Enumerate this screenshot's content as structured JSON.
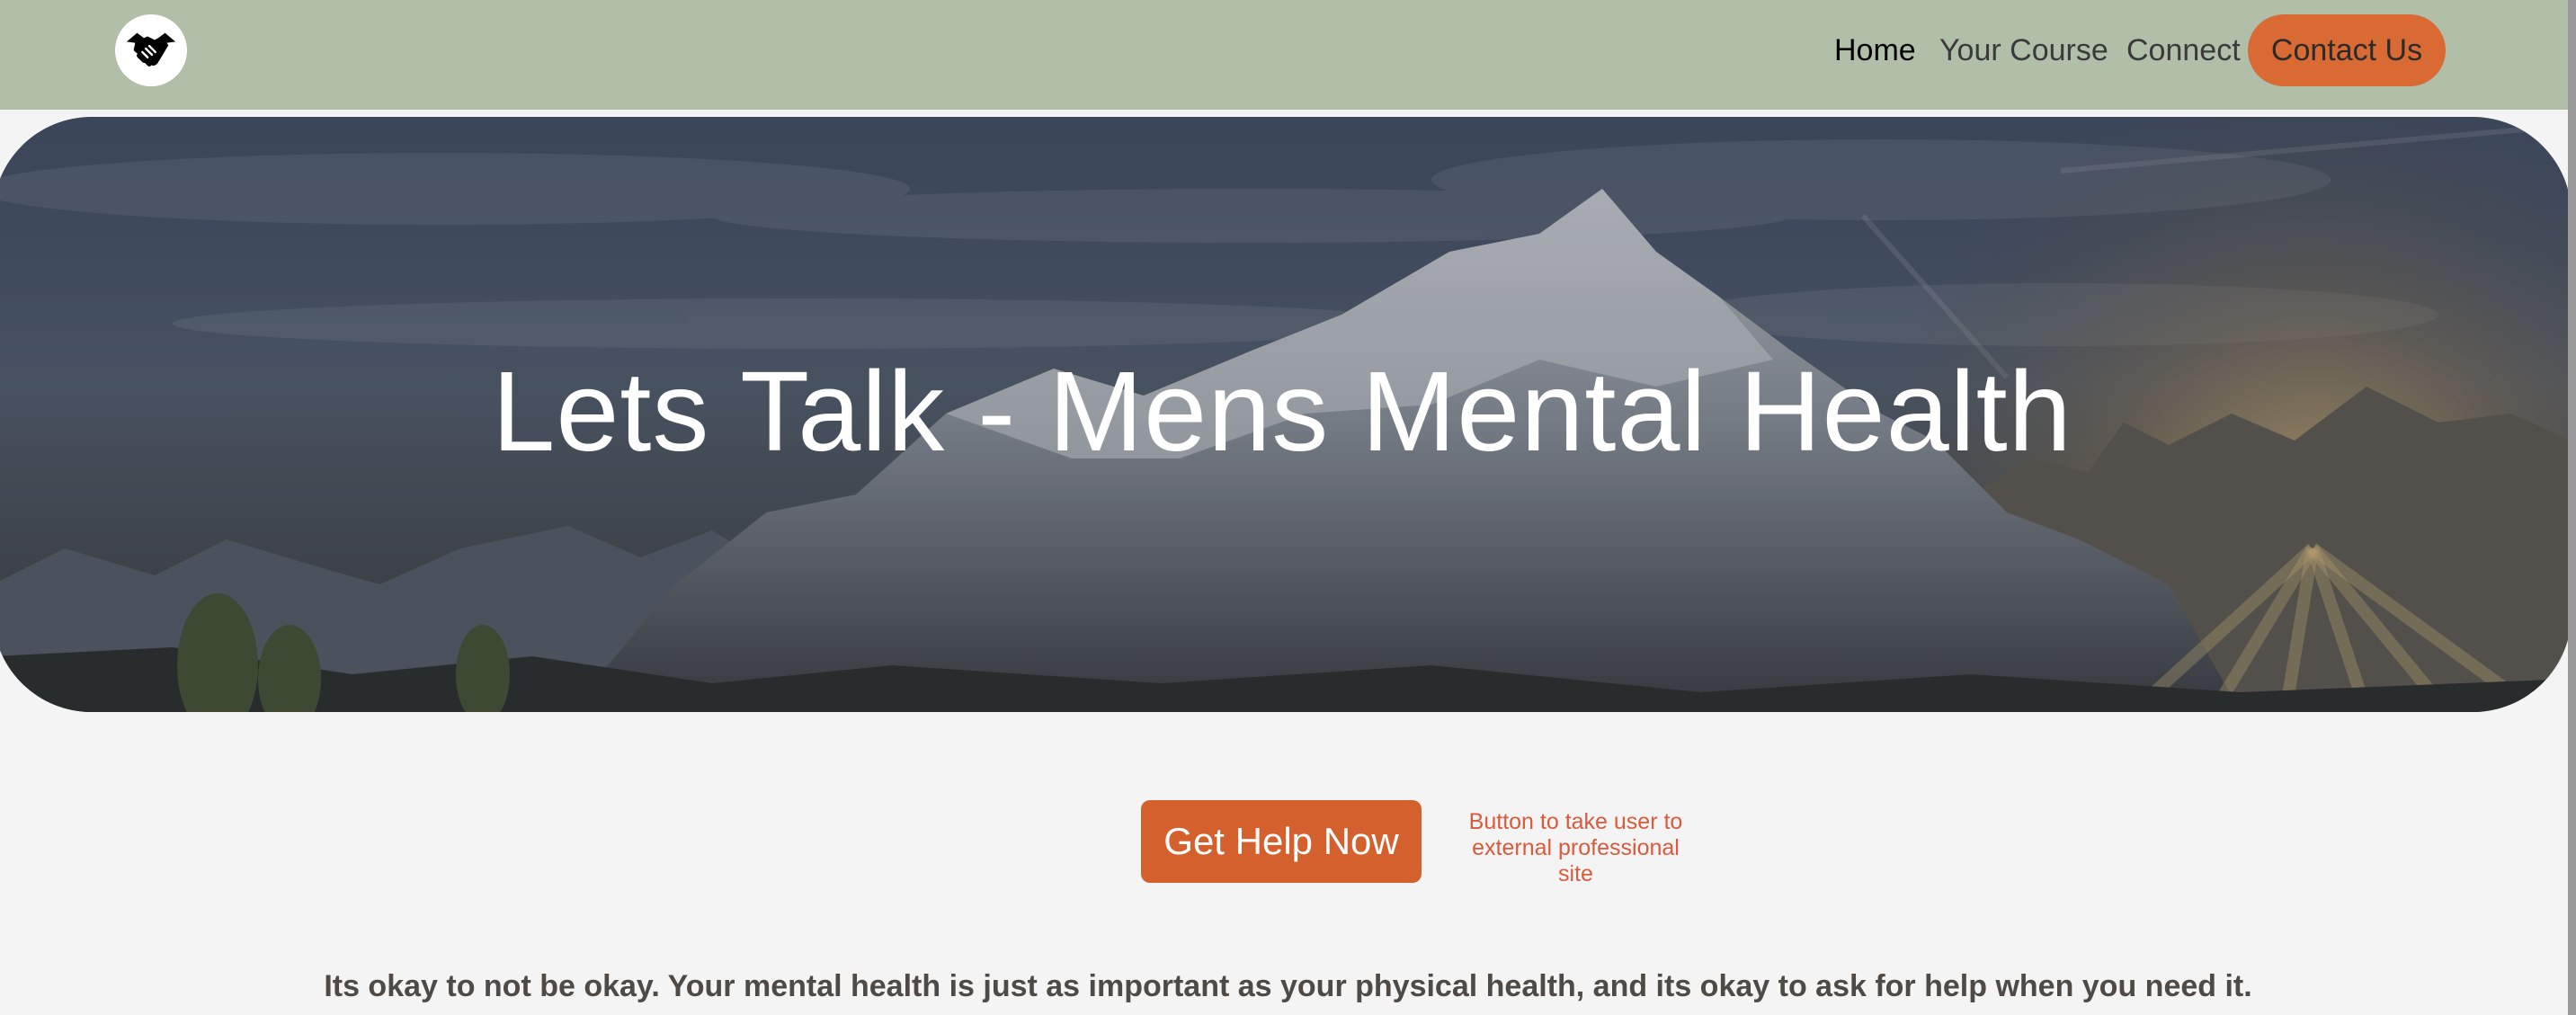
{
  "header": {
    "logo_icon": "handshake-icon",
    "nav": {
      "home": "Home",
      "your_course": "Your Course",
      "connect": "Connect",
      "contact_us": "Contact Us"
    }
  },
  "hero": {
    "title": "Lets Talk - Mens Mental Health",
    "background": "mountain-sunset-image"
  },
  "cta": {
    "button_label": "Get Help Now",
    "note": "Button to take user to external professional site"
  },
  "tagline": "Its okay to not be okay. Your mental health is just as important as your physical health, and its okay to ask for help when you need it.",
  "colors": {
    "header_bg": "#b1bfa9",
    "accent": "#d4602d",
    "page_bg": "#f4f4f4",
    "note_text": "#d95a3c"
  }
}
